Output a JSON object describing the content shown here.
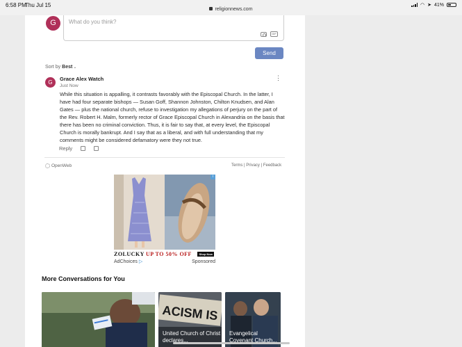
{
  "status_bar": {
    "time": "6:58 PM",
    "date": "Thu Jul 15",
    "url": "religionnews.com",
    "battery": "41%",
    "battery_level": 0.41
  },
  "comment_form": {
    "avatar_letter": "G",
    "placeholder": "What do you think?",
    "gif_label": "GIF",
    "send_label": "Send"
  },
  "sort": {
    "prefix": "Sort by",
    "value": "Best"
  },
  "comment": {
    "avatar_letter": "G",
    "author": "Grace Alex Watch",
    "time": "Just Now",
    "body": "While this situation is appalling, it contrasts favorably with the Episcopal Church. In the latter, I have had four separate bishops — Susan Goff, Shannon Johnston, Chilton Knudsen, and Alan Gates — plus the national church, refuse to investigation my allegations of perjury on the part of the Rev. Robert H. Malm, formerly rector of Grace Episcopal Church in Alexandria on the basis that there has been no criminal conviction. Thus, it is fair to say that, at every level, the Episcopal Church is morally bankrupt. And I say that as a liberal, and with full understanding that my comments might be considered defamatory were they not true.",
    "reply_label": "Reply",
    "menu_glyph": "⋮"
  },
  "footer": {
    "brand": "OpenWeb",
    "terms": "Terms",
    "privacy": "Privacy",
    "feedback": "Feedback",
    "separator": "|"
  },
  "ad": {
    "brand": "ZOLUCKY",
    "offer": "UP TO 50% OFF",
    "shop_label": "Shop Now",
    "adchoices": "AdChoices",
    "sponsored": "Sponsored"
  },
  "more": {
    "title": "More Conversations for You",
    "cards": [
      {
        "caption": ""
      },
      {
        "caption": "United Church of Christ declares..."
      },
      {
        "caption": "Evangelical Covenant Church..."
      }
    ]
  }
}
